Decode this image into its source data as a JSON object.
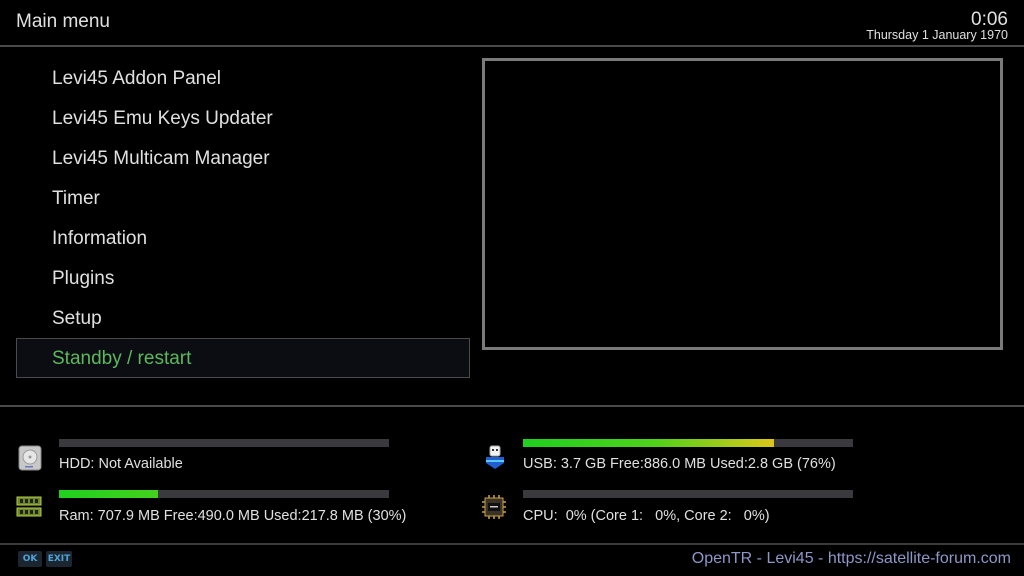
{
  "header": {
    "title": "Main menu",
    "clock": "0:06",
    "date": "Thursday  1 January 1970"
  },
  "menu": {
    "selected_index": 7,
    "items": [
      {
        "label": "Levi45 Addon Panel"
      },
      {
        "label": "Levi45 Emu Keys Updater"
      },
      {
        "label": "Levi45 Multicam Manager"
      },
      {
        "label": "Timer"
      },
      {
        "label": "Information"
      },
      {
        "label": "Plugins"
      },
      {
        "label": "Setup"
      },
      {
        "label": "Standby / restart"
      }
    ]
  },
  "stats": {
    "hdd": {
      "icon": "hdd-icon",
      "text": "HDD: Not Available",
      "percent": 0
    },
    "ram": {
      "icon": "ram-icon",
      "text": "Ram: 707.9 MB Free:490.0 MB Used:217.8 MB (30%)",
      "percent": 30
    },
    "usb": {
      "icon": "usb-icon",
      "text": "USB: 3.7 GB Free:886.0 MB Used:2.8 GB (76%)",
      "percent": 76
    },
    "cpu": {
      "icon": "cpu-icon",
      "text": "CPU:  0% (Core 1:   0%, Core 2:   0%)",
      "percent": 0
    }
  },
  "footer": {
    "ok_label": "OK",
    "exit_label": "EXIT",
    "brand": "OpenTR - Levi45 - https://satellite-forum.com"
  },
  "colors": {
    "selected_text": "#5cb85c",
    "footer_brand": "#8d97c8",
    "key_text": "#4fa3d8"
  }
}
